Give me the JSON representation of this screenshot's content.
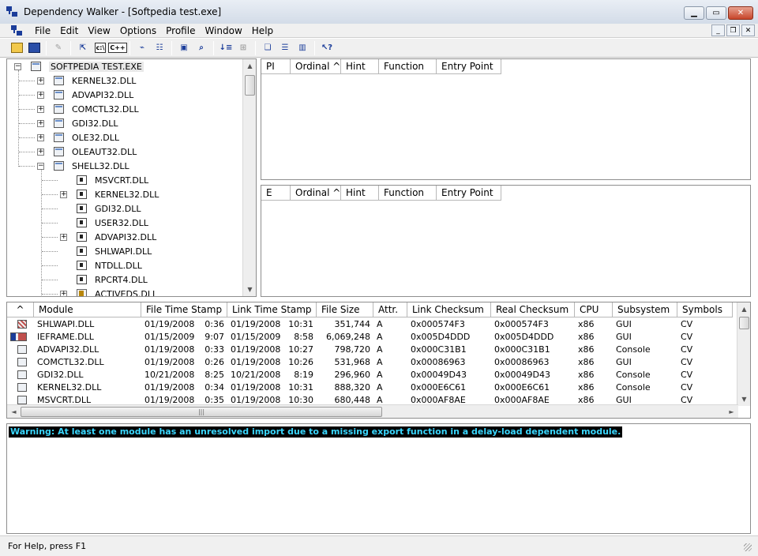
{
  "window": {
    "title": "Dependency Walker - [Softpedia test.exe]"
  },
  "menu": [
    "File",
    "Edit",
    "View",
    "Options",
    "Profile",
    "Window",
    "Help"
  ],
  "toolbar": {
    "c_label": "c:\\",
    "cpp_label": "C++"
  },
  "tree": {
    "root": "SOFTPEDIA TEST.EXE",
    "items": [
      {
        "label": "KERNEL32.DLL",
        "level": 1,
        "expander": "+",
        "icon": "module-icon"
      },
      {
        "label": "ADVAPI32.DLL",
        "level": 1,
        "expander": "+",
        "icon": "module-icon"
      },
      {
        "label": "COMCTL32.DLL",
        "level": 1,
        "expander": "+",
        "icon": "module-icon"
      },
      {
        "label": "GDI32.DLL",
        "level": 1,
        "expander": "+",
        "icon": "module-icon"
      },
      {
        "label": "OLE32.DLL",
        "level": 1,
        "expander": "+",
        "icon": "module-icon"
      },
      {
        "label": "OLEAUT32.DLL",
        "level": 1,
        "expander": "+",
        "icon": "module-icon"
      },
      {
        "label": "SHELL32.DLL",
        "level": 1,
        "expander": "−",
        "icon": "module-icon"
      },
      {
        "label": "MSVCRT.DLL",
        "level": 2,
        "expander": "",
        "icon": "forwarded-module-icon"
      },
      {
        "label": "KERNEL32.DLL",
        "level": 2,
        "expander": "+",
        "icon": "forwarded-module-icon"
      },
      {
        "label": "GDI32.DLL",
        "level": 2,
        "expander": "",
        "icon": "forwarded-module-icon"
      },
      {
        "label": "USER32.DLL",
        "level": 2,
        "expander": "",
        "icon": "forwarded-module-icon"
      },
      {
        "label": "ADVAPI32.DLL",
        "level": 2,
        "expander": "+",
        "icon": "forwarded-module-icon"
      },
      {
        "label": "SHLWAPI.DLL",
        "level": 2,
        "expander": "",
        "icon": "forwarded-module-icon"
      },
      {
        "label": "NTDLL.DLL",
        "level": 2,
        "expander": "",
        "icon": "forwarded-module-icon"
      },
      {
        "label": "RPCRT4.DLL",
        "level": 2,
        "expander": "",
        "icon": "forwarded-module-icon"
      },
      {
        "label": "ACTIVEDS.DLL",
        "level": 2,
        "expander": "+",
        "icon": "delay-load-module-icon"
      }
    ]
  },
  "imports": {
    "columns": [
      "PI",
      "Ordinal ^",
      "Hint",
      "Function",
      "Entry Point"
    ]
  },
  "exports": {
    "columns": [
      "E",
      "Ordinal ^",
      "Hint",
      "Function",
      "Entry Point"
    ]
  },
  "modules": {
    "columns": [
      "^",
      "Module",
      "File Time Stamp",
      "Link Time Stamp",
      "File Size",
      "Attr.",
      "Link Checksum",
      "Real Checksum",
      "CPU",
      "Subsystem",
      "Symbols"
    ],
    "rows": [
      {
        "icon": "red",
        "module": "SHLWAPI.DLL",
        "fdate": "01/19/2008",
        "ftime": "0:36",
        "ldate": "01/19/2008",
        "ltime": "10:31",
        "size": "351,744",
        "attr": "A",
        "lcs": "0x000574F3",
        "rcs": "0x000574F3",
        "cpu": "x86",
        "sub": "GUI",
        "sym": "CV"
      },
      {
        "icon": "hr",
        "module": "IEFRAME.DLL",
        "fdate": "01/15/2009",
        "ftime": "9:07",
        "ldate": "01/15/2009",
        "ltime": "8:58",
        "size": "6,069,248",
        "attr": "A",
        "lcs": "0x005D4DDD",
        "rcs": "0x005D4DDD",
        "cpu": "x86",
        "sub": "GUI",
        "sym": "CV"
      },
      {
        "icon": "",
        "module": "ADVAPI32.DLL",
        "fdate": "01/19/2008",
        "ftime": "0:33",
        "ldate": "01/19/2008",
        "ltime": "10:27",
        "size": "798,720",
        "attr": "A",
        "lcs": "0x000C31B1",
        "rcs": "0x000C31B1",
        "cpu": "x86",
        "sub": "Console",
        "sym": "CV"
      },
      {
        "icon": "",
        "module": "COMCTL32.DLL",
        "fdate": "01/19/2008",
        "ftime": "0:26",
        "ldate": "01/19/2008",
        "ltime": "10:26",
        "size": "531,968",
        "attr": "A",
        "lcs": "0x00086963",
        "rcs": "0x00086963",
        "cpu": "x86",
        "sub": "GUI",
        "sym": "CV"
      },
      {
        "icon": "",
        "module": "GDI32.DLL",
        "fdate": "10/21/2008",
        "ftime": "8:25",
        "ldate": "10/21/2008",
        "ltime": "8:19",
        "size": "296,960",
        "attr": "A",
        "lcs": "0x00049D43",
        "rcs": "0x00049D43",
        "cpu": "x86",
        "sub": "Console",
        "sym": "CV"
      },
      {
        "icon": "",
        "module": "KERNEL32.DLL",
        "fdate": "01/19/2008",
        "ftime": "0:34",
        "ldate": "01/19/2008",
        "ltime": "10:31",
        "size": "888,320",
        "attr": "A",
        "lcs": "0x000E6C61",
        "rcs": "0x000E6C61",
        "cpu": "x86",
        "sub": "Console",
        "sym": "CV"
      },
      {
        "icon": "",
        "module": "MSVCRT.DLL",
        "fdate": "01/19/2008",
        "ftime": "0:35",
        "ldate": "01/19/2008",
        "ltime": "10:30",
        "size": "680,448",
        "attr": "A",
        "lcs": "0x000AF8AE",
        "rcs": "0x000AF8AE",
        "cpu": "x86",
        "sub": "GUI",
        "sym": "CV"
      }
    ]
  },
  "log": {
    "warning": "Warning: At least one module has an unresolved import due to a missing export function in a delay-load dependent module."
  },
  "status": {
    "text": "For Help, press F1"
  }
}
